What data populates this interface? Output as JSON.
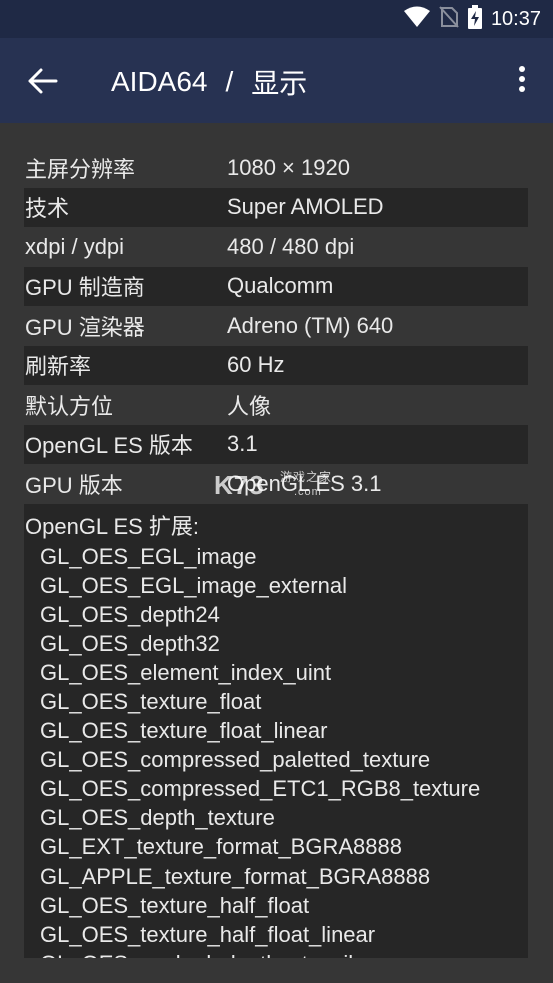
{
  "status": {
    "time": "10:37",
    "icons": [
      "wifi-icon",
      "no-sim-icon",
      "battery-charging-icon"
    ]
  },
  "appbar": {
    "app_name": "AIDA64",
    "separator": "/",
    "page_name": "显示"
  },
  "rows": [
    {
      "key": "主屏分辨率",
      "value": "1080 × 1920"
    },
    {
      "key": "技术",
      "value": "Super AMOLED"
    },
    {
      "key": "xdpi / ydpi",
      "value": "480 / 480 dpi"
    },
    {
      "key": "GPU 制造商",
      "value": "Qualcomm"
    },
    {
      "key": "GPU 渲染器",
      "value": "Adreno (TM) 640"
    },
    {
      "key": "刷新率",
      "value": "60 Hz"
    },
    {
      "key": "默认方位",
      "value": "人像"
    },
    {
      "key": "OpenGL ES 版本",
      "value": "3.1"
    },
    {
      "key": "GPU 版本",
      "value": "OpenGL ES 3.1"
    }
  ],
  "extensions": {
    "title": "OpenGL ES 扩展:",
    "items": [
      "GL_OES_EGL_image",
      "GL_OES_EGL_image_external",
      "GL_OES_depth24",
      "GL_OES_depth32",
      "GL_OES_element_index_uint",
      "GL_OES_texture_float",
      "GL_OES_texture_float_linear",
      "GL_OES_compressed_paletted_texture",
      "GL_OES_compressed_ETC1_RGB8_texture",
      "GL_OES_depth_texture",
      "GL_EXT_texture_format_BGRA8888",
      "GL_APPLE_texture_format_BGRA8888",
      "GL_OES_texture_half_float",
      "GL_OES_texture_half_float_linear",
      "GL_OES_packed_depth_stencil"
    ]
  },
  "watermark": {
    "brand": "K73",
    "tagline": "游戏之家",
    "domain": ".com"
  }
}
